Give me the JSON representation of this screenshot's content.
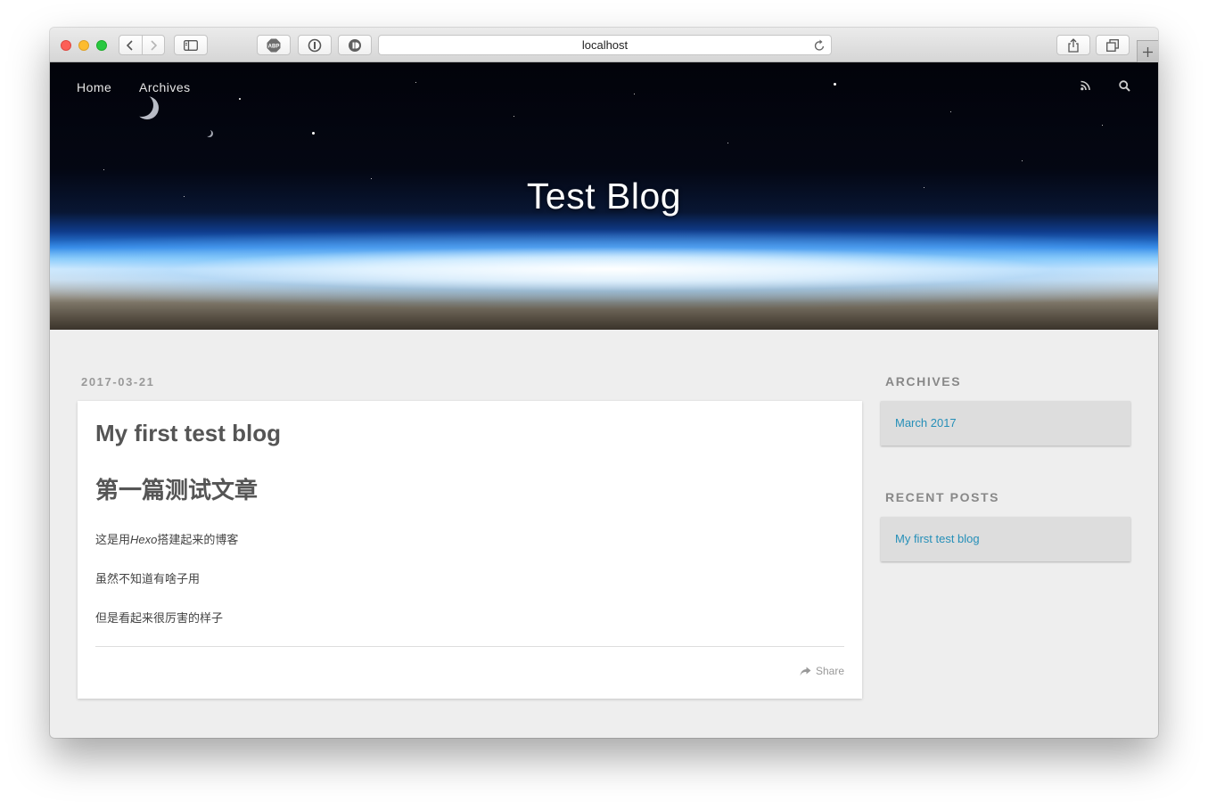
{
  "browser": {
    "address": "localhost",
    "abp_label": "ABP"
  },
  "site": {
    "nav": [
      "Home",
      "Archives"
    ],
    "title": "Test Blog"
  },
  "post": {
    "date": "2017-03-21",
    "title": "My first test blog",
    "heading": "第一篇测试文章",
    "para1_before": "这是用",
    "para1_em": "Hexo",
    "para1_after": "搭建起来的博客",
    "para2": "虽然不知道有啥子用",
    "para3": "但是看起来很厉害的样子",
    "share_label": "Share"
  },
  "sidebar": {
    "archives_title": "ARCHIVES",
    "archives_link": "March 2017",
    "recent_title": "RECENT POSTS",
    "recent_link": "My first test blog"
  },
  "colors": {
    "link": "#258fb8",
    "page_bg": "#eeeeee"
  },
  "icons": [
    "rss-icon",
    "search-icon",
    "share-icon",
    "reload-icon"
  ]
}
